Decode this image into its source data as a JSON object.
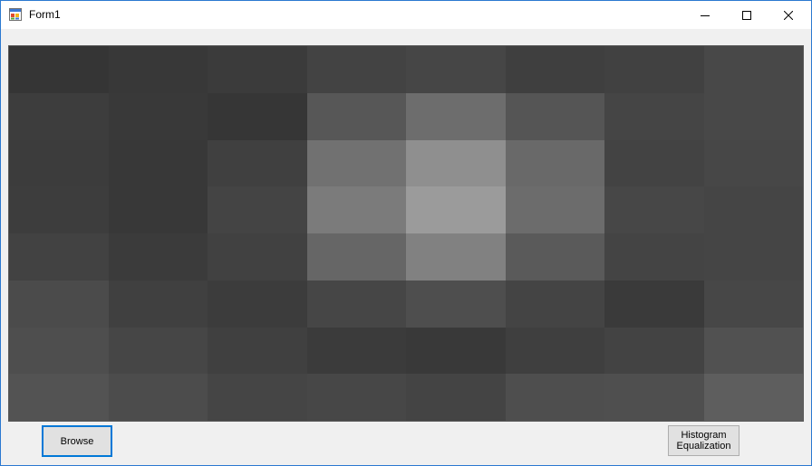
{
  "window": {
    "title": "Form1",
    "icon": "windows-form-icon",
    "controls": [
      "minimize-icon",
      "maximize-icon",
      "close-icon"
    ]
  },
  "image": {
    "rows": 8,
    "cols": 8,
    "grid": [
      [
        "#353535",
        "#383838",
        "#3b3b3b",
        "#434343",
        "#464646",
        "#3f3f3f",
        "#414141",
        "#484848"
      ],
      [
        "#3d3d3d",
        "#393939",
        "#363636",
        "#575757",
        "#6d6d6d",
        "#555555",
        "#454545",
        "#484848"
      ],
      [
        "#3c3c3c",
        "#383838",
        "#404040",
        "#717171",
        "#8f8f8f",
        "#696969",
        "#434343",
        "#474747"
      ],
      [
        "#3d3d3d",
        "#383838",
        "#444444",
        "#7b7b7b",
        "#9b9b9b",
        "#6c6c6c",
        "#474747",
        "#454545"
      ],
      [
        "#424242",
        "#3b3b3b",
        "#414141",
        "#666666",
        "#818181",
        "#5a5a5a",
        "#444444",
        "#454545"
      ],
      [
        "#4b4b4b",
        "#404040",
        "#3c3c3c",
        "#464646",
        "#4e4e4e",
        "#444444",
        "#3a3a3a",
        "#474747"
      ],
      [
        "#4e4e4e",
        "#464646",
        "#404040",
        "#3b3b3b",
        "#393939",
        "#3f3f3f",
        "#434343",
        "#515151"
      ],
      [
        "#535353",
        "#4c4c4c",
        "#454545",
        "#474747",
        "#444444",
        "#4e4e4e",
        "#4f4f4f",
        "#5e5e5e"
      ]
    ]
  },
  "buttons": {
    "browse": "Browse",
    "histogram_line1": "Histogram",
    "histogram_line2": "Equalization"
  }
}
